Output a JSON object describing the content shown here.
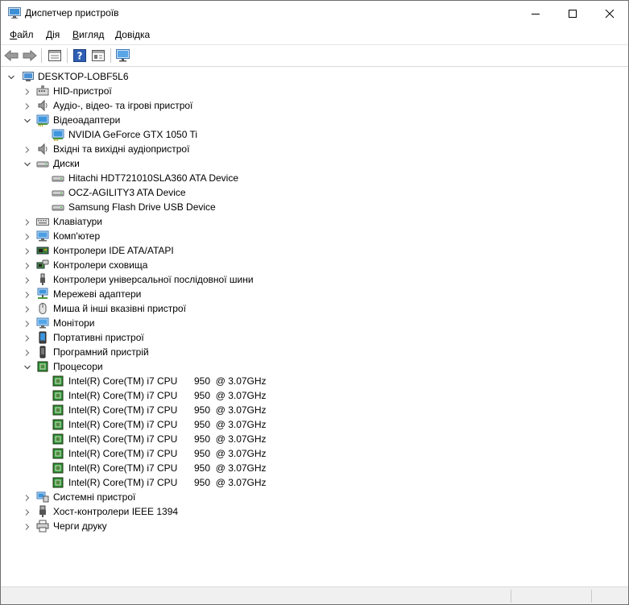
{
  "window": {
    "title": "Диспетчер пристроїв"
  },
  "menu": [
    {
      "label_u": "Ф",
      "label_rest": "айл"
    },
    {
      "label_u": "Д",
      "label_rest": "ія"
    },
    {
      "label_u": "В",
      "label_rest": "игляд"
    },
    {
      "label_u": "Д",
      "label_rest": "овідка"
    }
  ],
  "toolbar": {
    "buttons": [
      "back-arrow-icon",
      "forward-arrow-icon",
      "properties-icon",
      "help-icon",
      "show-hidden-icon",
      "monitor-scan-icon"
    ]
  },
  "tree": {
    "root": "DESKTOP-LOBF5L6",
    "categories": [
      {
        "label": "HID-пристрої",
        "icon": "hid-icon",
        "expanded": false
      },
      {
        "label": "Аудіо-, відео- та ігрові пристрої",
        "icon": "speaker-icon",
        "expanded": false
      },
      {
        "label": "Відеоадаптери",
        "icon": "display-adapter-icon",
        "expanded": true,
        "children": [
          {
            "label": "NVIDIA GeForce GTX 1050 Ti",
            "icon": "display-adapter-icon"
          }
        ]
      },
      {
        "label": "Вхідні та вихідні аудіопристрої",
        "icon": "speaker-icon",
        "expanded": false
      },
      {
        "label": "Диски",
        "icon": "disk-drive-icon",
        "expanded": true,
        "children": [
          {
            "label": "Hitachi HDT721010SLA360 ATA Device",
            "icon": "disk-drive-icon"
          },
          {
            "label": "OCZ-AGILITY3 ATA Device",
            "icon": "disk-drive-icon"
          },
          {
            "label": "Samsung Flash Drive USB Device",
            "icon": "disk-drive-icon"
          }
        ]
      },
      {
        "label": "Клавіатури",
        "icon": "keyboard-icon",
        "expanded": false
      },
      {
        "label": "Комп'ютер",
        "icon": "computer-icon",
        "expanded": false
      },
      {
        "label": "Контролери IDE ATA/ATAPI",
        "icon": "ide-controller-icon",
        "expanded": false
      },
      {
        "label": "Контролери сховища",
        "icon": "storage-controller-icon",
        "expanded": false
      },
      {
        "label": "Контролери універсальної послідовної шини",
        "icon": "usb-icon",
        "expanded": false
      },
      {
        "label": "Мережеві адаптери",
        "icon": "network-adapter-icon",
        "expanded": false
      },
      {
        "label": "Миша й інші вказівні пристрої",
        "icon": "mouse-icon",
        "expanded": false
      },
      {
        "label": "Монітори",
        "icon": "monitor-icon",
        "expanded": false
      },
      {
        "label": "Портативні пристрої",
        "icon": "portable-device-icon",
        "expanded": false
      },
      {
        "label": "Програмний пристрій",
        "icon": "software-device-icon",
        "expanded": false
      },
      {
        "label": "Процесори",
        "icon": "processor-icon",
        "expanded": true,
        "children": [
          {
            "label": "Intel(R) Core(TM) i7 CPU",
            "freq": "950  @ 3.07GHz",
            "icon": "processor-icon"
          },
          {
            "label": "Intel(R) Core(TM) i7 CPU",
            "freq": "950  @ 3.07GHz",
            "icon": "processor-icon"
          },
          {
            "label": "Intel(R) Core(TM) i7 CPU",
            "freq": "950  @ 3.07GHz",
            "icon": "processor-icon"
          },
          {
            "label": "Intel(R) Core(TM) i7 CPU",
            "freq": "950  @ 3.07GHz",
            "icon": "processor-icon"
          },
          {
            "label": "Intel(R) Core(TM) i7 CPU",
            "freq": "950  @ 3.07GHz",
            "icon": "processor-icon"
          },
          {
            "label": "Intel(R) Core(TM) i7 CPU",
            "freq": "950  @ 3.07GHz",
            "icon": "processor-icon"
          },
          {
            "label": "Intel(R) Core(TM) i7 CPU",
            "freq": "950  @ 3.07GHz",
            "icon": "processor-icon"
          },
          {
            "label": "Intel(R) Core(TM) i7 CPU",
            "freq": "950  @ 3.07GHz",
            "icon": "processor-icon"
          }
        ]
      },
      {
        "label": "Системні пристрої",
        "icon": "system-device-icon",
        "expanded": false
      },
      {
        "label": "Хост-контролери IEEE 1394",
        "icon": "ieee1394-icon",
        "expanded": false
      },
      {
        "label": "Черги друку",
        "icon": "printer-icon",
        "expanded": false
      }
    ]
  }
}
